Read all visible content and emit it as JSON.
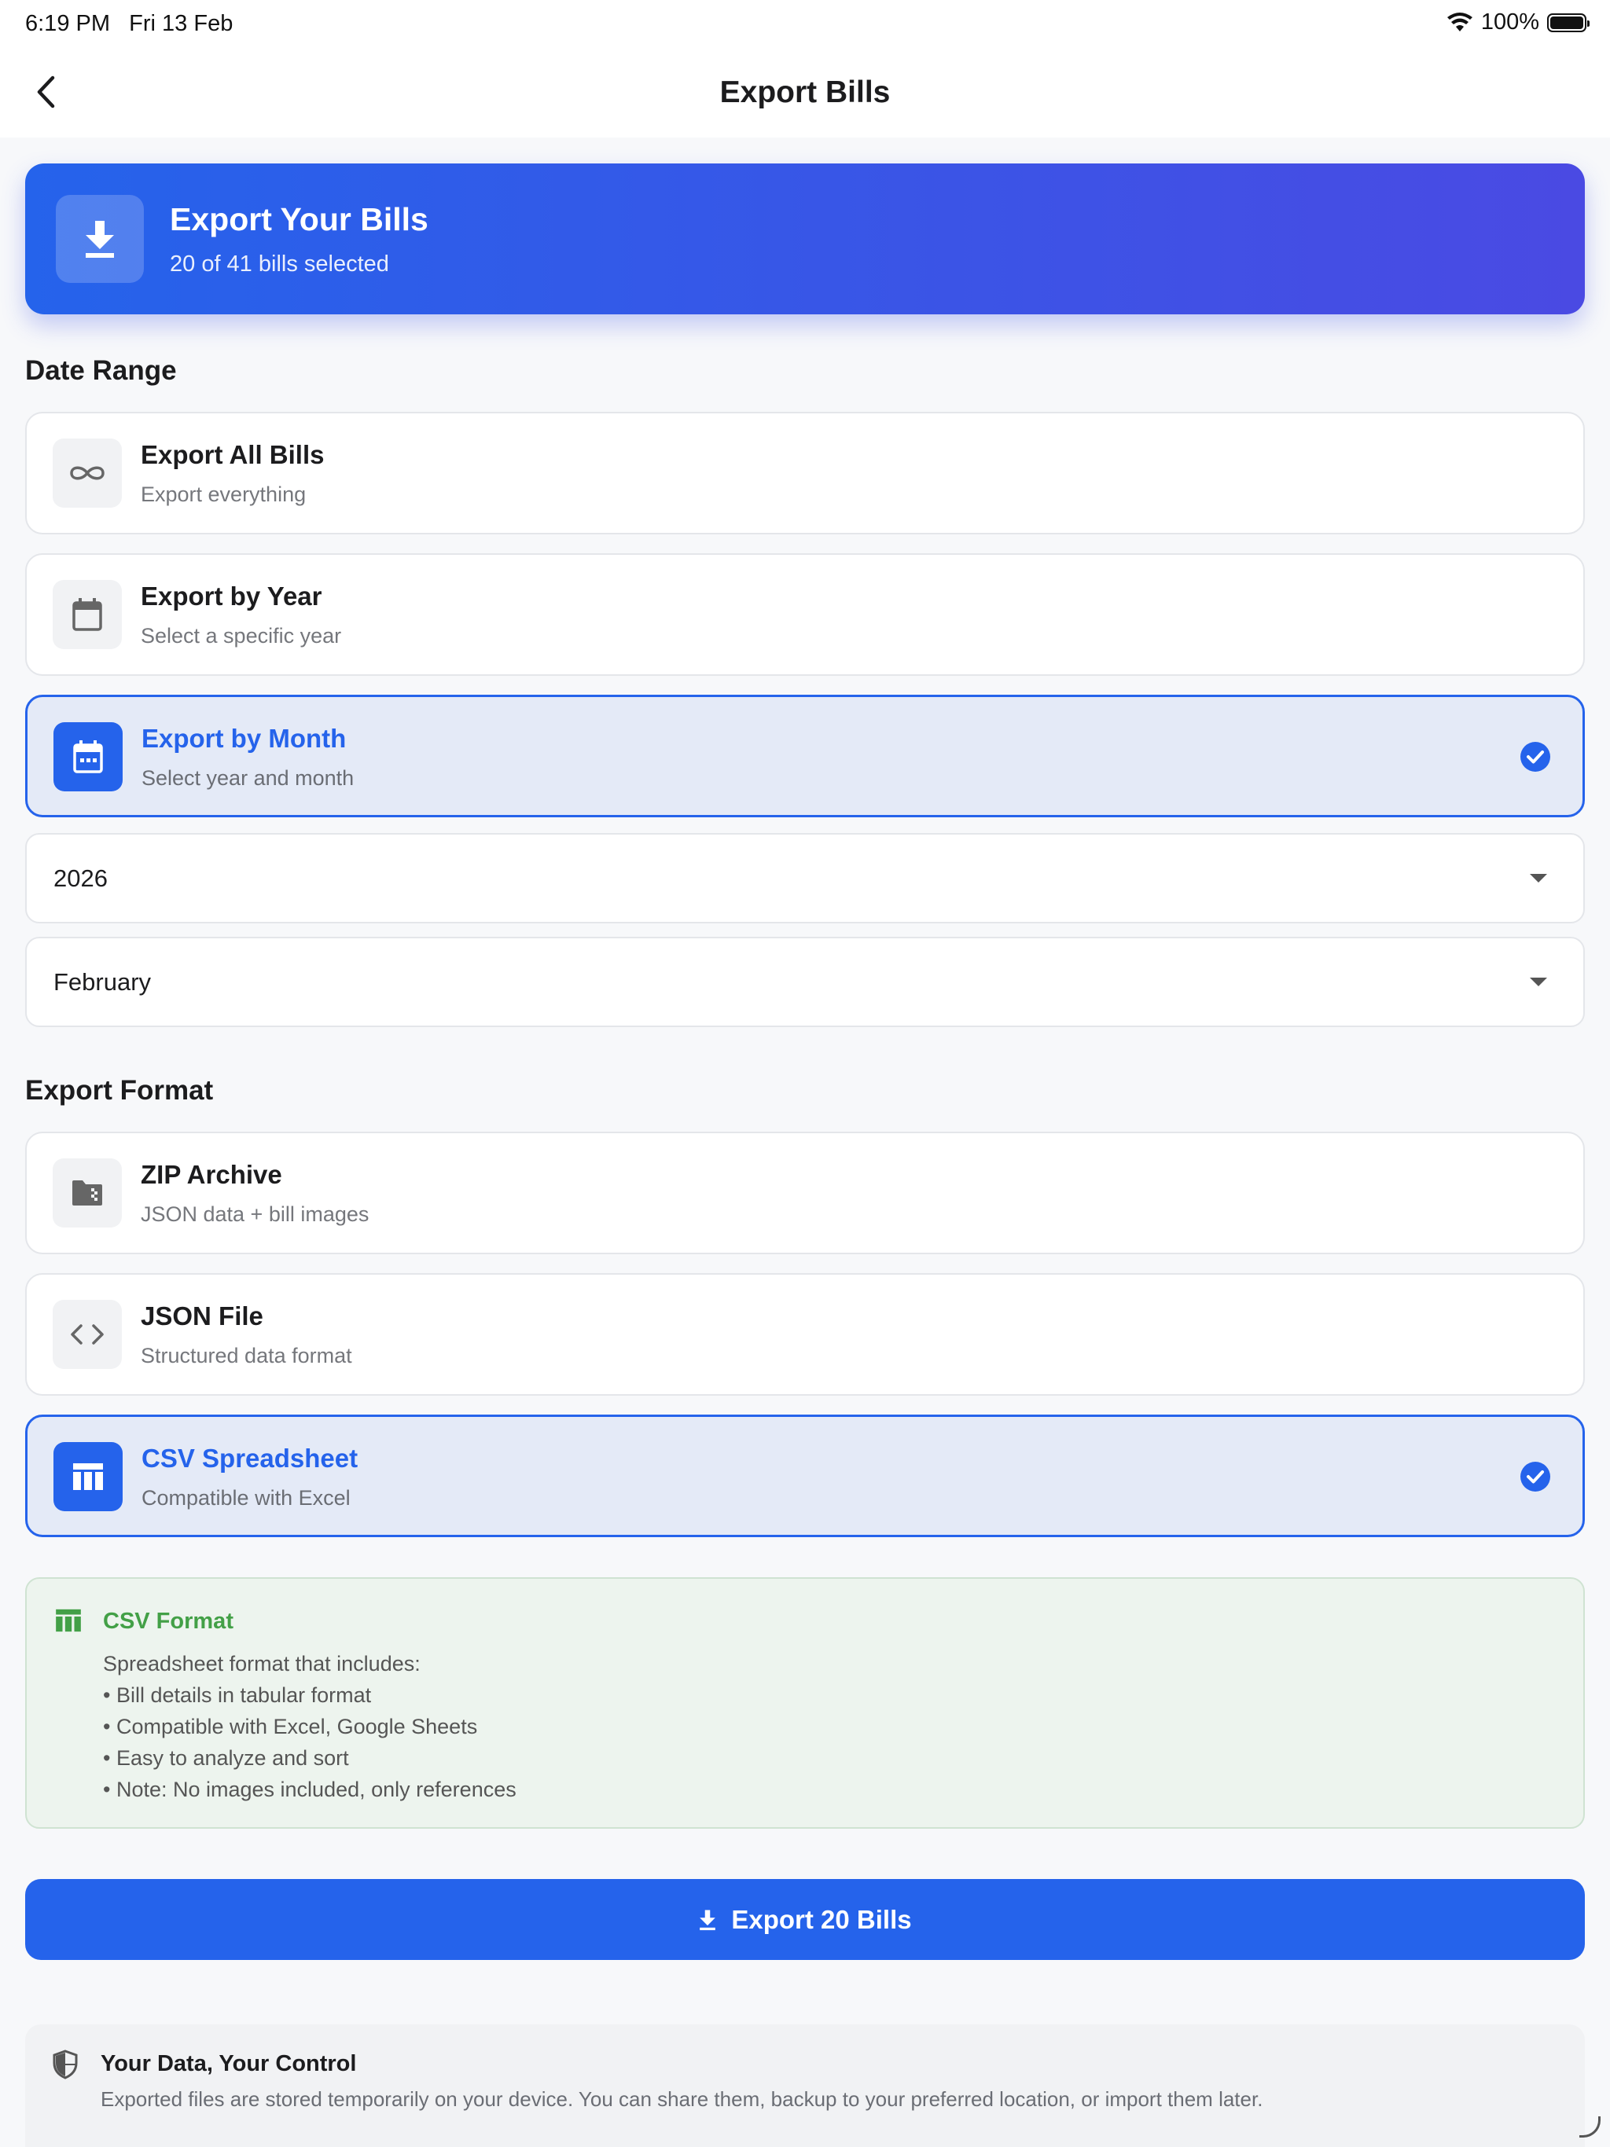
{
  "status_bar": {
    "time": "6:19 PM",
    "date": "Fri 13 Feb",
    "battery": "100%",
    "battery_level": 1.0
  },
  "nav": {
    "title": "Export Bills",
    "back_icon": "chevron-left-icon"
  },
  "hero": {
    "title": "Export Your Bills",
    "subtitle": "20 of 41 bills selected",
    "icon": "download-icon"
  },
  "date_range": {
    "title": "Date Range",
    "options": [
      {
        "title": "Export All Bills",
        "subtitle": "Export everything",
        "icon": "infinity-icon",
        "selected": false
      },
      {
        "title": "Export by Year",
        "subtitle": "Select a specific year",
        "icon": "calendar-icon",
        "selected": false
      },
      {
        "title": "Export by Month",
        "subtitle": "Select year and month",
        "icon": "calendar-month-icon",
        "selected": true
      }
    ],
    "year_select": {
      "value": "2026"
    },
    "month_select": {
      "value": "February"
    }
  },
  "export_format": {
    "title": "Export Format",
    "options": [
      {
        "title": "ZIP Archive",
        "subtitle": "JSON data + bill images",
        "icon": "folder-zip-icon",
        "selected": false
      },
      {
        "title": "JSON File",
        "subtitle": "Structured data format",
        "icon": "code-icon",
        "selected": false
      },
      {
        "title": "CSV Spreadsheet",
        "subtitle": "Compatible with Excel",
        "icon": "table-icon",
        "selected": true
      }
    ]
  },
  "info": {
    "title": "CSV Format",
    "lines": [
      "Spreadsheet format that includes:",
      "• Bill details in tabular format",
      "• Compatible with Excel, Google Sheets",
      "• Easy to analyze and sort",
      "• Note: No images included, only references"
    ]
  },
  "export_button": {
    "label": "Export 20 Bills",
    "icon": "download-icon"
  },
  "privacy": {
    "title": "Your Data, Your Control",
    "text": "Exported files are stored temporarily on your device. You can share them, backup to your preferred location, or import them later.",
    "icon": "shield-icon"
  },
  "colors": {
    "primary": "#2563eb",
    "hero_end": "#4a4ae3",
    "success": "#43a047",
    "selected_bg": "#e4eaf7"
  }
}
